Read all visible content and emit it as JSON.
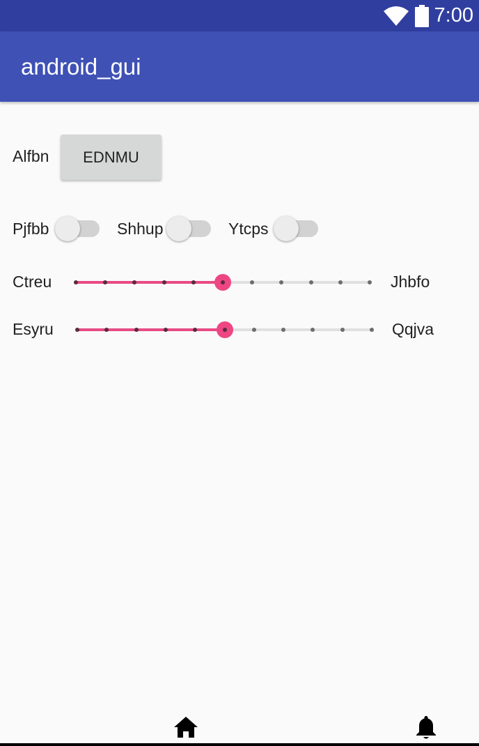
{
  "status_bar": {
    "time": "7:00",
    "icons": [
      "wifi-icon",
      "battery-icon"
    ]
  },
  "app_bar": {
    "title": "android_gui"
  },
  "row1": {
    "label": "Alfbn",
    "button_label": "EDNMU"
  },
  "switches": [
    {
      "label": "Pjfbb",
      "checked": false
    },
    {
      "label": "Shhup",
      "checked": false
    },
    {
      "label": "Ytcps",
      "checked": false
    }
  ],
  "sliders": [
    {
      "left_label": "Ctreu",
      "right_label": "Jhbfo",
      "min": 0,
      "max": 10,
      "value": 5
    },
    {
      "left_label": "Esyru",
      "right_label": "Qqjva",
      "min": 0,
      "max": 10,
      "value": 5
    }
  ],
  "colors": {
    "status_bar": "#303f9f",
    "app_bar": "#3f51b5",
    "accent": "#ee4583",
    "background": "#fafafa",
    "button": "#d6d7d7"
  },
  "bottom_nav": {
    "icons": [
      "home-icon",
      "notifications-icon"
    ]
  }
}
